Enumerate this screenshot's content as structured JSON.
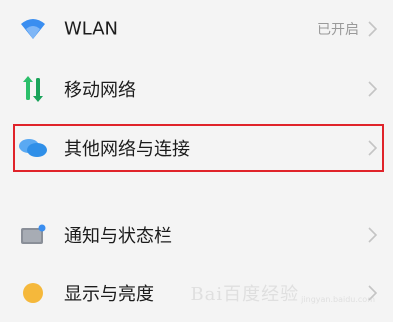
{
  "settings": {
    "items": [
      {
        "label": "WLAN",
        "status": "已开启",
        "icon": "wifi-icon"
      },
      {
        "label": "移动网络",
        "status": "",
        "icon": "mobile-data-icon"
      },
      {
        "label": "其他网络与连接",
        "status": "",
        "icon": "connections-icon",
        "highlighted": true
      },
      {
        "label": "通知与状态栏",
        "status": "",
        "icon": "notification-icon"
      },
      {
        "label": "显示与亮度",
        "status": "",
        "icon": "brightness-icon"
      }
    ]
  },
  "watermark": {
    "text": "Bai百度经验",
    "sub": "jingyan.baidu.com"
  },
  "colors": {
    "highlight": "#e0232a",
    "wifi": "#3a8ef0",
    "mobile_up": "#2bbf6a",
    "mobile_down": "#1aa35a",
    "connections": "#2f8fe8",
    "brightness": "#f5b83b"
  }
}
